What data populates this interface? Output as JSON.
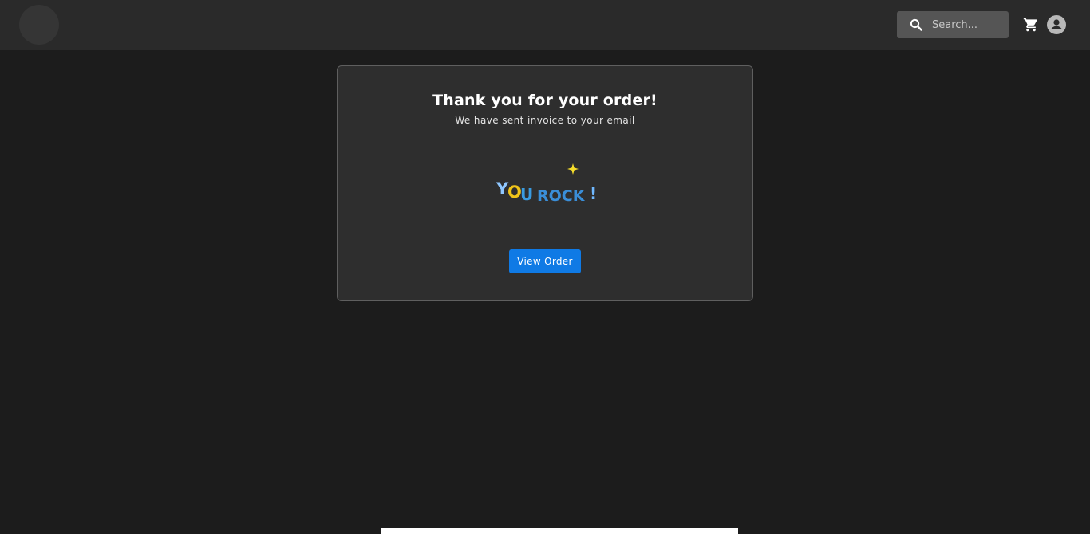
{
  "header": {
    "search": {
      "placeholder": "Search..."
    },
    "icons": [
      "logo",
      "search-icon",
      "cart-icon",
      "account-icon"
    ]
  },
  "order_confirmation": {
    "title": "Thank you for your order!",
    "subtitle": "We have sent invoice to your email",
    "illustration_text": "YOU ROCK !",
    "view_order_label": "View Order"
  },
  "colors": {
    "background": "#1c1c1c",
    "topbar": "#2a2a2a",
    "card": "#2e2e2e",
    "card_border": "#5f5f5f",
    "accent": "#0f7ae5",
    "search_bg": "#555555",
    "sparkle": "#f5dd2b"
  }
}
